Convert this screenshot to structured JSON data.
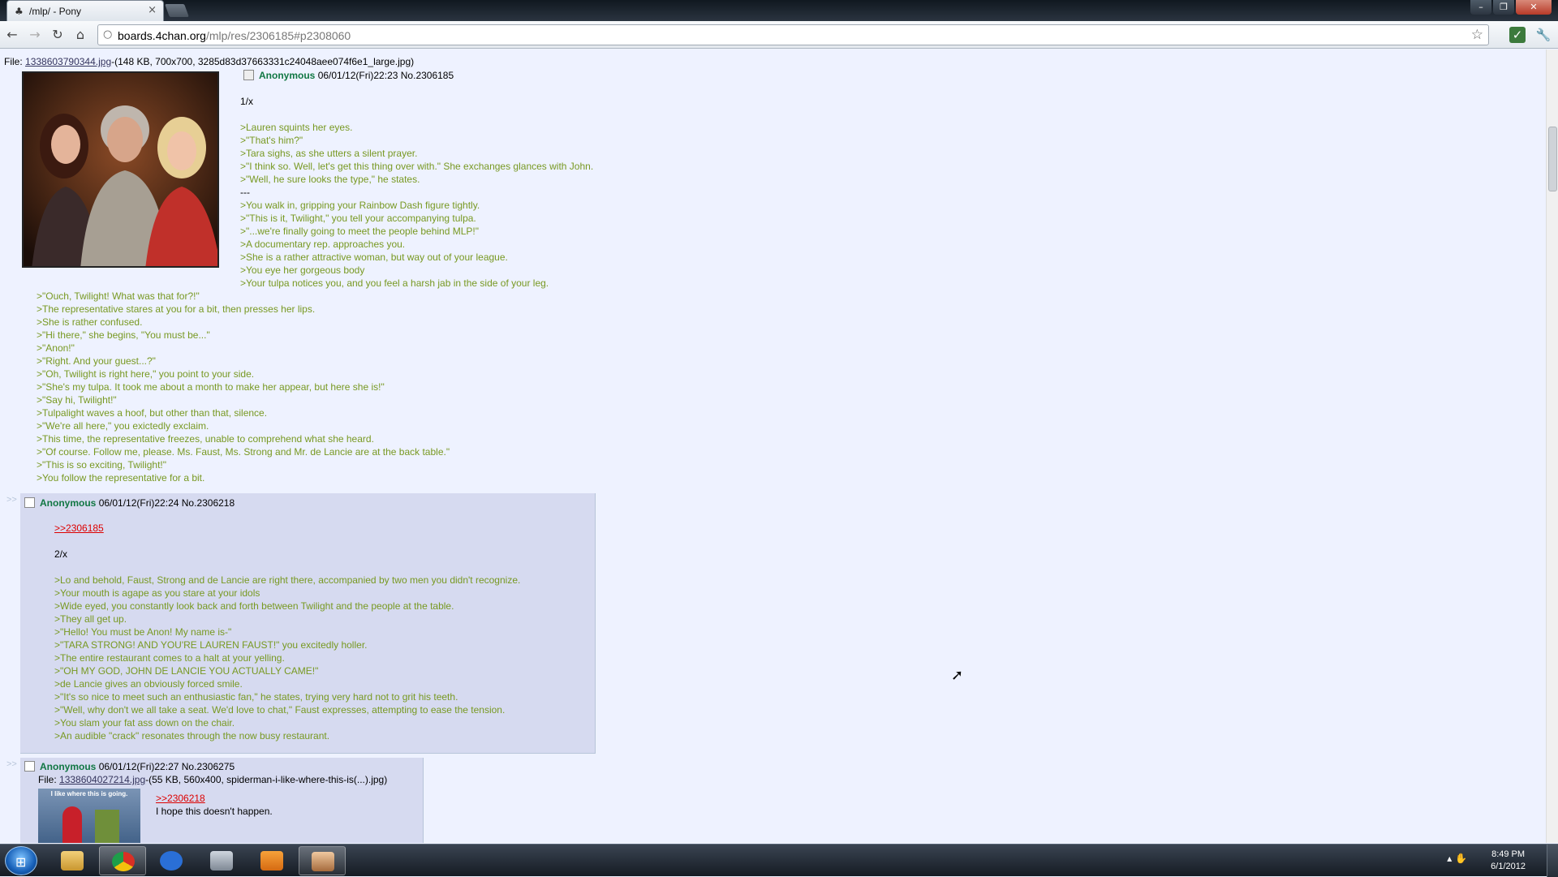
{
  "browser": {
    "tab_title": "/mlp/ - Pony",
    "url_domain": "boards.4chan.org",
    "url_path": "/mlp/res/2306185#p2308060"
  },
  "op": {
    "file_label": "File: ",
    "file_name": "1338603790344.jpg",
    "file_meta": "-(148 KB, 700x700, 3285d83d37663331c24048aee074f6e1_large.jpg)",
    "name": "Anonymous",
    "datetime": "06/01/12(Fri)22:23",
    "number": "No.2306185",
    "first_line": "1/x",
    "lines_right": [
      ">Lauren squints her eyes.",
      ">\"That's him?\"",
      ">Tara sighs, as she utters a silent prayer.",
      ">\"I think so. Well, let's get this thing over with.\" She exchanges glances with John.",
      ">\"Well, he sure looks the type,\" he states.",
      "---",
      ">You walk in, gripping your Rainbow Dash figure tightly.",
      ">\"This is it, Twilight,\" you tell your accompanying tulpa.",
      ">\"...we're finally going to meet the people behind MLP!\"",
      ">A documentary rep. approaches you.",
      ">She is a rather attractive woman, but way out of your league.",
      ">You eye her gorgeous body",
      ">Your tulpa notices you, and you feel a harsh jab in the side of your leg."
    ],
    "lines_left": [
      ">\"Ouch, Twilight! What was that for?!\"",
      ">The representative stares at you for a bit, then presses her lips.",
      ">She is rather confused.",
      ">\"Hi there,\" she begins, \"You must be...\"",
      ">\"Anon!\"",
      ">\"Right. And your guest...?\"",
      ">\"Oh, Twilight is right here,\" you point to your side.",
      ">\"She's my tulpa. It took me about a month to make her appear, but here she is!\"",
      ">\"Say hi, Twilight!\"",
      ">Tulpalight waves a hoof, but other than that, silence.",
      ">\"We're all here,\" you exictedly exclaim.",
      ">This time, the representative freezes, unable to comprehend what she heard.",
      ">\"Of course. Follow me, please. Ms. Faust, Ms. Strong and Mr. de Lancie are at the back table.\"",
      ">\"This is so exciting, Twilight!\"",
      ">You follow the representative for a bit."
    ]
  },
  "reply1": {
    "arrows": ">>",
    "name": "Anonymous",
    "datetime": "06/01/12(Fri)22:24",
    "number": "No.2306218",
    "quote_link": ">>2306185",
    "first_line": "2/x",
    "lines": [
      ">Lo and behold, Faust, Strong and de Lancie are right there, accompanied by two men you didn't recognize.",
      ">Your mouth is agape as you stare at your idols",
      ">Wide eyed, you constantly look back and forth between Twilight and the people at the table.",
      ">They all get up.",
      ">\"Hello! You must be Anon! My name is-\"",
      ">\"TARA STRONG! AND YOU'RE LAUREN FAUST!\" you excitedly holler.",
      ">The entire restaurant comes to a halt at your yelling.",
      ">\"OH MY GOD, JOHN DE LANCIE YOU ACTUALLY CAME!\"",
      ">de Lancie gives an obviously forced smile.",
      ">\"It's so nice to meet such an enthusiastic fan,\" he states, trying very hard not to grit his teeth.",
      ">\"Well, why don't we all take a seat. We'd love to chat,\" Faust expresses, attempting to ease the tension.",
      ">You slam your fat ass down on the chair.",
      ">An audible \"crack\" resonates through the now busy restaurant."
    ]
  },
  "reply2": {
    "arrows": ">>",
    "name": "Anonymous",
    "datetime": "06/01/12(Fri)22:27",
    "number": "No.2306275",
    "file_label": "File: ",
    "file_name": "1338604027214.jpg",
    "file_meta": "-(55 KB, 560x400, spiderman-i-like-where-this-is(...).jpg)",
    "thumb_caption": "I like where this is going.",
    "quote_link": ">>2306218",
    "text": "I hope this doesn't happen."
  },
  "taskbar": {
    "time": "8:49 PM",
    "date": "6/1/2012"
  },
  "colors": {
    "page_bg": "#eef2ff",
    "reply_bg": "#d6daf0",
    "greentext": "#789922",
    "name": "#117743",
    "quote_link": "#dd0000"
  }
}
